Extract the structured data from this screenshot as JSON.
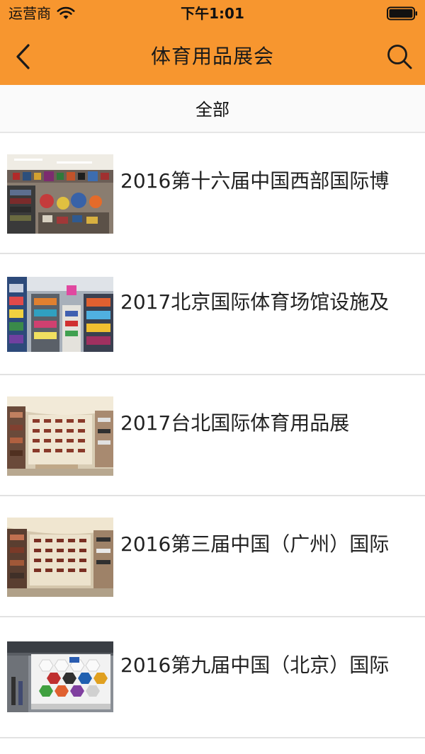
{
  "status_bar": {
    "carrier": "运营商",
    "time": "下午1:01"
  },
  "navbar": {
    "title": "体育用品展会",
    "back_icon": "chevron-left-icon",
    "search_icon": "search-icon"
  },
  "filter": {
    "label": "全部"
  },
  "colors": {
    "header": "#F7962F",
    "divider": "#E2E2E2"
  },
  "items": [
    {
      "title": "2016第十六届中国西部国际博"
    },
    {
      "title": "2017北京国际体育场馆设施及"
    },
    {
      "title": "2017台北国际体育用品展"
    },
    {
      "title": "2016第三届中国（广州）国际"
    },
    {
      "title": "2016第九届中国（北京）国际"
    }
  ]
}
